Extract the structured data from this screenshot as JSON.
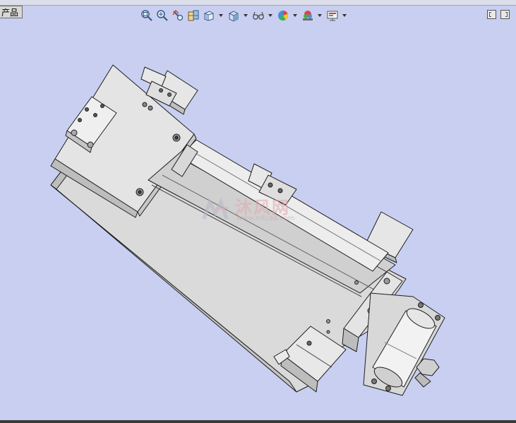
{
  "tab": {
    "label": "产品"
  },
  "toolbar": {
    "buttons": [
      {
        "name": "zoom-to-fit",
        "icon": "zoom-to-fit-icon"
      },
      {
        "name": "zoom-to-area",
        "icon": "zoom-to-area-icon"
      },
      {
        "name": "previous-view",
        "icon": "previous-view-icon"
      },
      {
        "name": "section-view",
        "icon": "section-view-icon"
      },
      {
        "name": "view-orientation",
        "icon": "view-orientation-icon"
      },
      {
        "name": "display-style",
        "icon": "display-style-icon"
      },
      {
        "name": "hide-show-items",
        "icon": "hide-show-items-icon"
      },
      {
        "name": "edit-appearance",
        "icon": "edit-appearance-icon"
      },
      {
        "name": "apply-scene",
        "icon": "apply-scene-icon"
      },
      {
        "name": "view-settings",
        "icon": "view-settings-icon"
      }
    ]
  },
  "watermark": {
    "text": "沐风网",
    "url": "www.mfcad.com"
  },
  "colors": {
    "viewport_background": "#c9cff0",
    "part_fill": "#e2e2e2",
    "edge": "#1e1e1e"
  }
}
